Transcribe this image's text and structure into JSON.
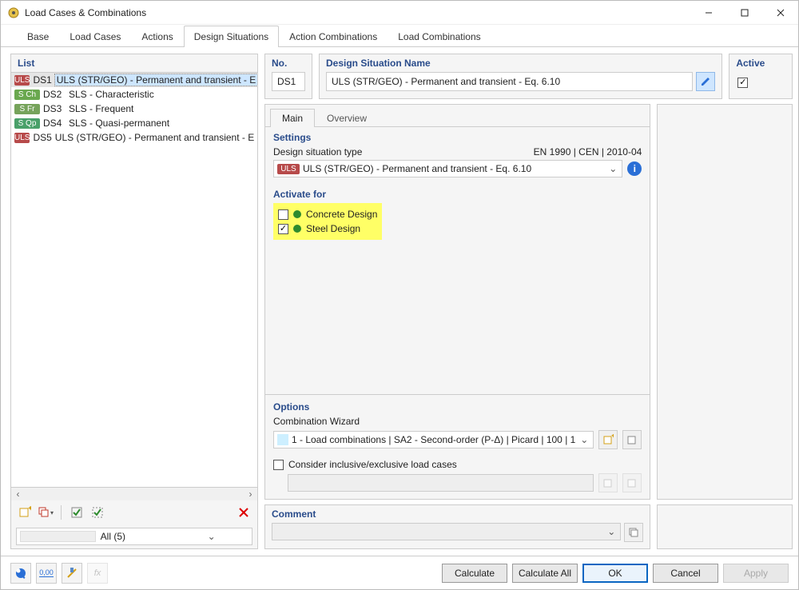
{
  "window": {
    "title": "Load Cases & Combinations"
  },
  "tabs": [
    "Base",
    "Load Cases",
    "Actions",
    "Design Situations",
    "Action Combinations",
    "Load Combinations"
  ],
  "active_tab_index": 3,
  "left": {
    "title": "List",
    "items": [
      {
        "tag": "ULS",
        "tagcls": "uls",
        "dsn": "DS1",
        "name": "ULS (STR/GEO) - Permanent and transient - E",
        "sel": true
      },
      {
        "tag": "S Ch",
        "tagcls": "sch",
        "dsn": "DS2",
        "name": "SLS - Characteristic"
      },
      {
        "tag": "S Fr",
        "tagcls": "sfr",
        "dsn": "DS3",
        "name": "SLS - Frequent"
      },
      {
        "tag": "S Qp",
        "tagcls": "sqp",
        "dsn": "DS4",
        "name": "SLS - Quasi-permanent"
      },
      {
        "tag": "ULS",
        "tagcls": "uls",
        "dsn": "DS5",
        "name": "ULS (STR/GEO) - Permanent and transient - E"
      }
    ],
    "filter_label": "All (5)"
  },
  "top": {
    "no_title": "No.",
    "no_value": "DS1",
    "dsn_title": "Design Situation Name",
    "dsn_value": "ULS (STR/GEO) - Permanent and transient - Eq. 6.10",
    "active_title": "Active",
    "active_checked": true
  },
  "subtabs": [
    "Main",
    "Overview"
  ],
  "active_subtab_index": 0,
  "settings": {
    "title": "Settings",
    "type_label": "Design situation type",
    "standard": "EN 1990 | CEN | 2010-04",
    "type_tag": "ULS",
    "type_value": "ULS (STR/GEO) - Permanent and transient - Eq. 6.10"
  },
  "activate": {
    "title": "Activate for",
    "items": [
      {
        "label": "Concrete Design",
        "checked": false
      },
      {
        "label": "Steel Design",
        "checked": true
      }
    ]
  },
  "options": {
    "title": "Options",
    "cw_label": "Combination Wizard",
    "cw_value": "1 - Load combinations | SA2 - Second-order (P-Δ) | Picard | 100 | 1",
    "consider_label": "Consider inclusive/exclusive load cases",
    "consider_checked": false
  },
  "comment": {
    "title": "Comment",
    "value": ""
  },
  "footer": {
    "calculate": "Calculate",
    "calculate_all": "Calculate All",
    "ok": "OK",
    "cancel": "Cancel",
    "apply": "Apply"
  }
}
